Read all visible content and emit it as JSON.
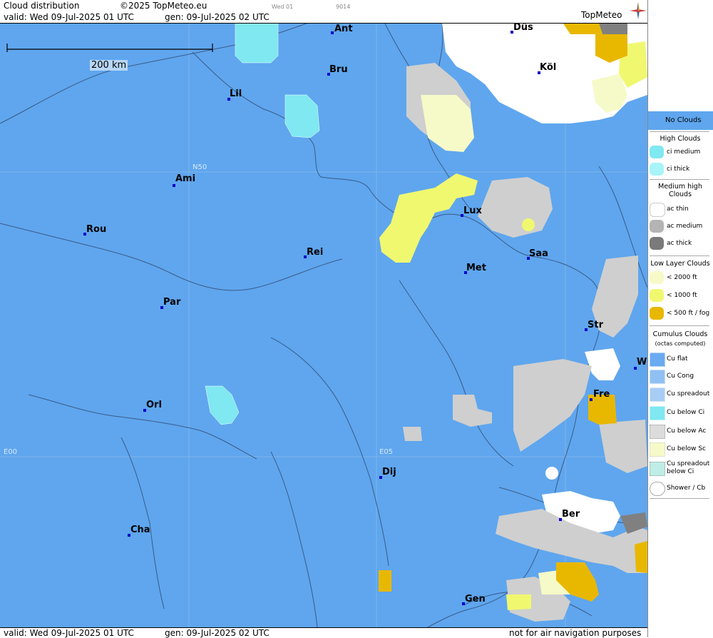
{
  "header": {
    "title": "Cloud distribution",
    "copyright": "©2025 TopMeteo.eu",
    "valid": "valid:  Wed  09-Jul-2025  01 UTC",
    "gen": "gen: 09-Jul-2025 02 UTC",
    "small_day": "Wed 01",
    "small_code": "9014",
    "logo": "TopMeteo"
  },
  "map": {
    "scale_label": "200 km",
    "grid_labels": {
      "lat": "N50",
      "lon0": "E00",
      "lon5": "E05"
    },
    "cities": [
      {
        "name": "Ant"
      },
      {
        "name": "Düs"
      },
      {
        "name": "Bru"
      },
      {
        "name": "Köl"
      },
      {
        "name": "Lil"
      },
      {
        "name": "Ami"
      },
      {
        "name": "Lux"
      },
      {
        "name": "Rou"
      },
      {
        "name": "Rei"
      },
      {
        "name": "Saa"
      },
      {
        "name": "Met"
      },
      {
        "name": "Par"
      },
      {
        "name": "Str"
      },
      {
        "name": "W"
      },
      {
        "name": "Fre"
      },
      {
        "name": "Orl"
      },
      {
        "name": "Dij"
      },
      {
        "name": "Ber"
      },
      {
        "name": "Cha"
      },
      {
        "name": "Gen"
      }
    ]
  },
  "footer": {
    "valid": "valid:  Wed  09-Jul-2025  01 UTC",
    "gen": "gen: 09-Jul-2025 02 UTC",
    "note": "not for air navigation purposes"
  },
  "legend": {
    "no_clouds": "No Clouds",
    "high_clouds": "High Clouds",
    "ci_medium": "ci medium",
    "ci_thick": "ci thick",
    "medium_high": "Medium high Clouds",
    "ac_thin": "ac thin",
    "ac_medium": "ac medium",
    "ac_thick": "ac thick",
    "low_layer": "Low Layer Clouds",
    "lt2000": "< 2000 ft",
    "lt1000": "< 1000 ft",
    "lt500": "< 500 ft / fog",
    "cumulus": "Cumulus Clouds",
    "octas": "(octas computed)",
    "cu_flat": "Cu flat",
    "cu_cong": "Cu Cong",
    "cu_spreadout": "Cu spreadout",
    "cu_below_ci": "Cu below Ci",
    "cu_below_ac": "Cu below Ac",
    "cu_below_sc": "Cu below Sc",
    "cu_spreadout_below_ci": "Cu spreadout below Ci",
    "shower_cb": "Shower / Cb"
  },
  "colors": {
    "no_clouds": "#5fa6ee",
    "ci_medium": "#7fe8f0",
    "ci_thick": "#a8f4f8",
    "ac_thin": "#ffffff",
    "ac_medium": "#b4b4b4",
    "ac_thick": "#7a7a7a",
    "low_2000": "#f6fac8",
    "low_1000": "#f0f870",
    "low_500": "#e8b800",
    "city_dot": "#0000cc"
  }
}
